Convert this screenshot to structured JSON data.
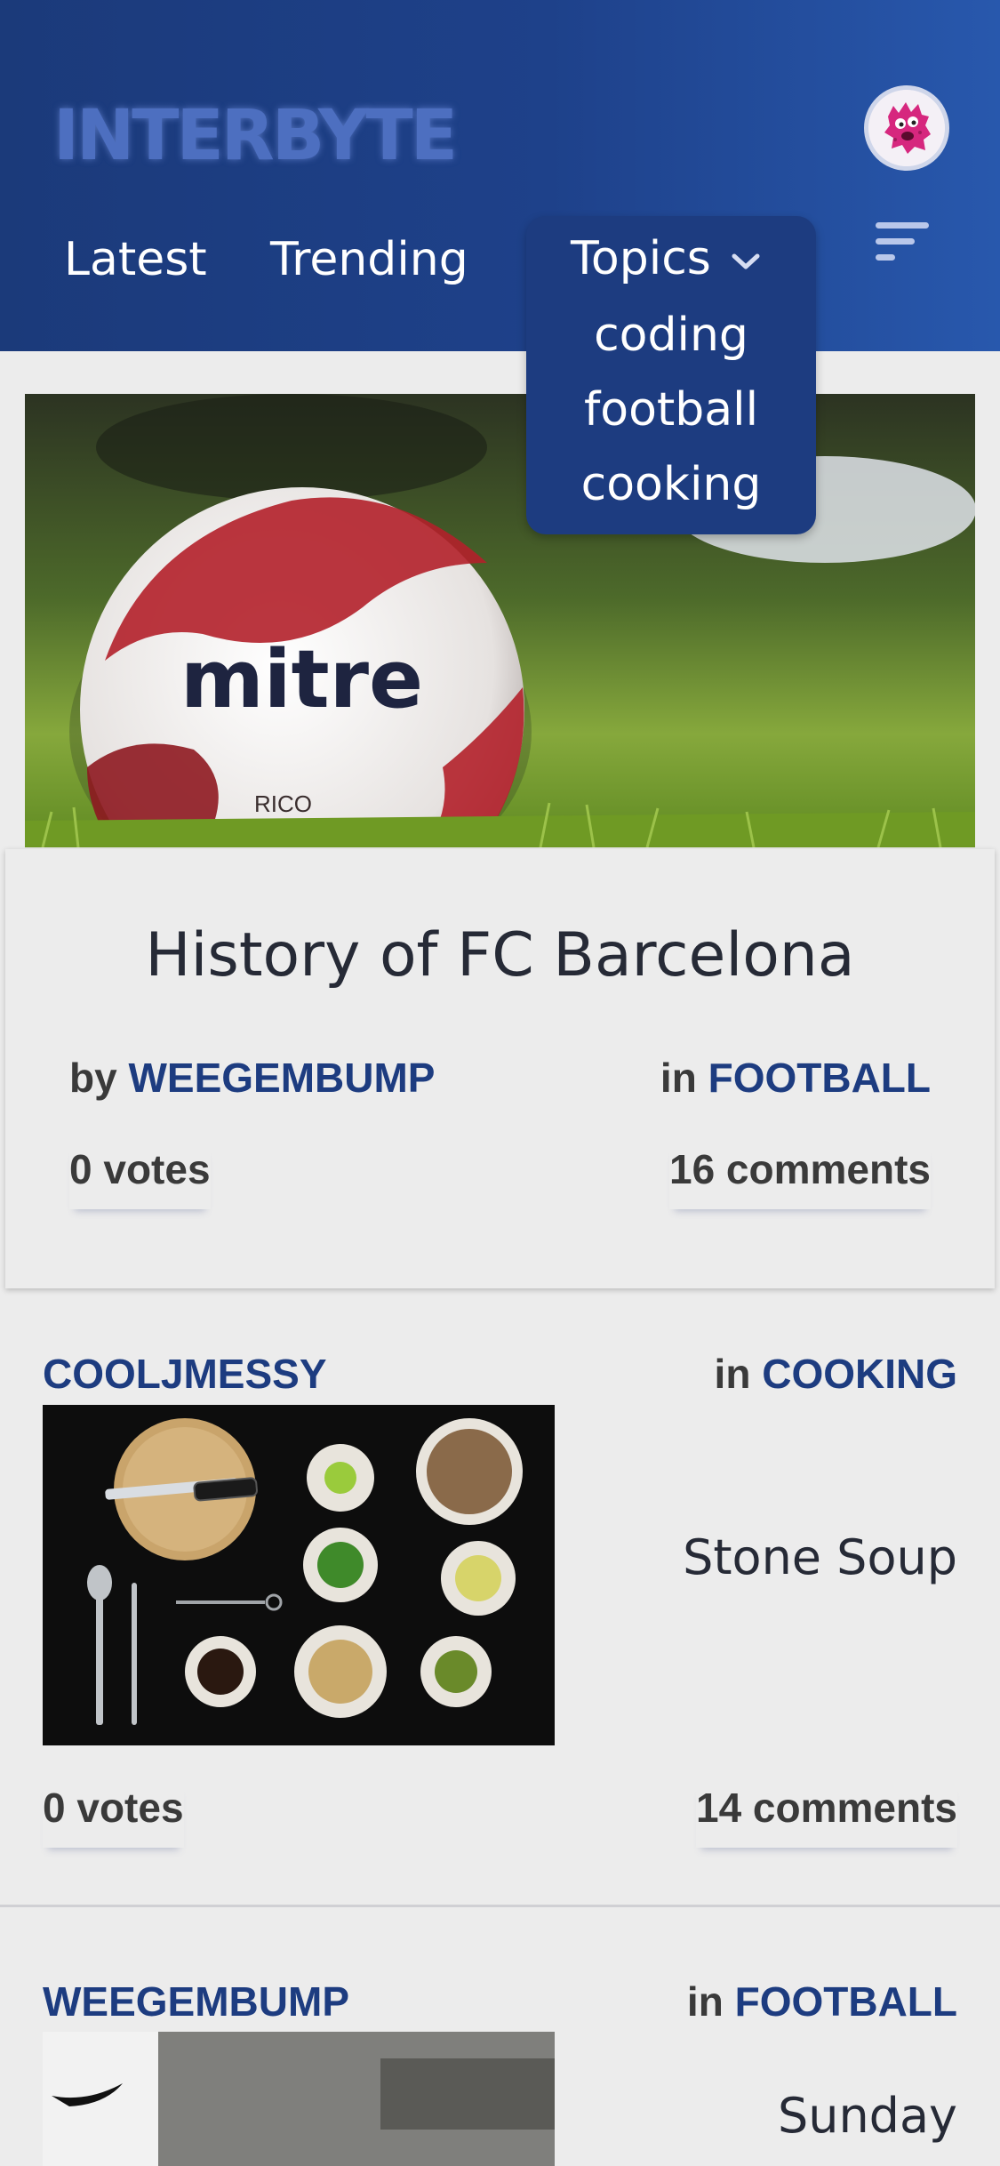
{
  "app": {
    "logo_text": "INTERBYTE"
  },
  "nav": {
    "latest": "Latest",
    "trending": "Trending",
    "topics": "Topics",
    "topics_options": [
      "coding",
      "football",
      "cooking"
    ]
  },
  "featured": {
    "title": "History of FC Barcelona",
    "by_label": "by",
    "author": "WEEGEMBUMP",
    "in_label": "in",
    "topic": "FOOTBALL",
    "votes": "0 votes",
    "comments": "16 comments",
    "image_ball_text": "mitre",
    "image_ball_subtext": "RICO"
  },
  "posts": [
    {
      "author": "COOLJMESSY",
      "in_label": "in",
      "topic": "COOKING",
      "title": "Stone Soup",
      "votes": "0 votes",
      "comments": "14 comments"
    },
    {
      "author": "WEEGEMBUMP",
      "in_label": "in",
      "topic": "FOOTBALL",
      "title": "Sunday"
    }
  ],
  "colors": {
    "header_dark": "#1b3a7a",
    "header_light": "#2858ad",
    "accent": "#1d3c80",
    "background": "#ececec"
  }
}
